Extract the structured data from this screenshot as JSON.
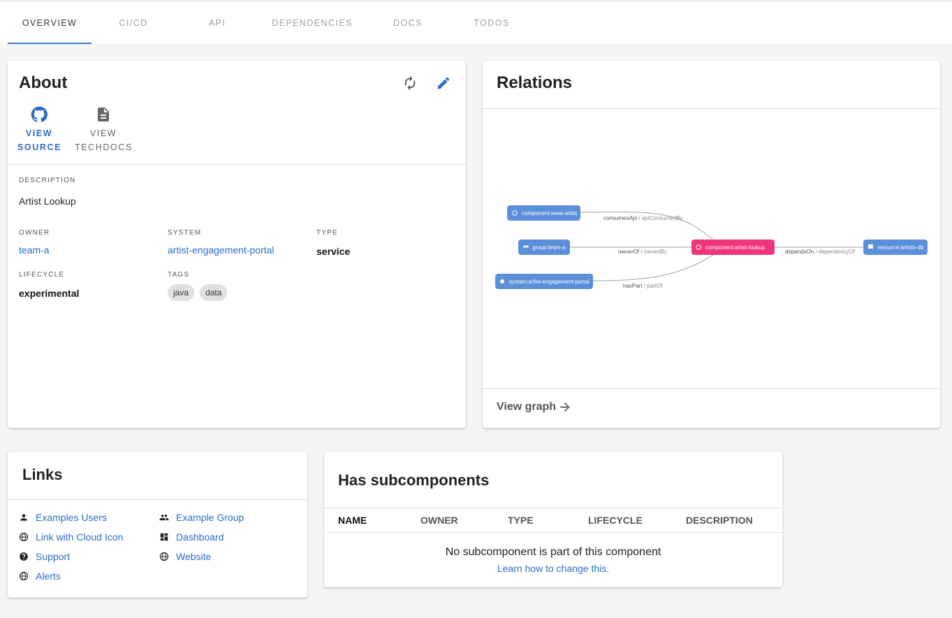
{
  "tabs": [
    "OVERVIEW",
    "CI/CD",
    "API",
    "DEPENDENCIES",
    "DOCS",
    "TODOS"
  ],
  "about": {
    "title": "About",
    "view_source": [
      "VIEW",
      "SOURCE"
    ],
    "view_techdocs": [
      "VIEW",
      "TECHDOCS"
    ],
    "description_label": "DESCRIPTION",
    "description": "Artist Lookup",
    "owner_label": "OWNER",
    "owner": "team-a",
    "system_label": "SYSTEM",
    "system": "artist-engagement-portal",
    "type_label": "TYPE",
    "type": "service",
    "lifecycle_label": "LIFECYCLE",
    "lifecycle": "experimental",
    "tags_label": "TAGS",
    "tags": [
      "java",
      "data"
    ]
  },
  "relations": {
    "title": "Relations",
    "nodes": {
      "www": "component:www-artist",
      "group": "group:team-a",
      "system": "system:artist-engagement-portal",
      "center": "component:artist-lookup",
      "resource": "resource:artists-db"
    },
    "edges": {
      "consumes_a": "consumesApi",
      "consumes_b": " / apiConsumedBy",
      "owner_a": "ownerOf",
      "owner_b": " / ownedBy",
      "haspart_a": "hasPart",
      "haspart_b": " / partOf",
      "depends_a": "dependsOn",
      "depends_b": " / dependencyOf"
    },
    "view_graph": "View graph"
  },
  "links": {
    "title": "Links",
    "items": [
      {
        "label": "Examples Users",
        "icon": "person-icon"
      },
      {
        "label": "Example Group",
        "icon": "group-icon"
      },
      {
        "label": "Link with Cloud Icon",
        "icon": "globe-icon"
      },
      {
        "label": "Dashboard",
        "icon": "dashboard-icon"
      },
      {
        "label": "Support",
        "icon": "help-icon"
      },
      {
        "label": "Website",
        "icon": "globe-icon"
      },
      {
        "label": "Alerts",
        "icon": "globe-icon"
      }
    ]
  },
  "subcomponents": {
    "title": "Has subcomponents",
    "columns": [
      "NAME",
      "OWNER",
      "TYPE",
      "LIFECYCLE",
      "DESCRIPTION"
    ],
    "empty_text": "No subcomponent is part of this component",
    "learn_link": "Learn how to change this."
  },
  "colors": {
    "accent": "#3a79c8",
    "node_blue": "#5b8fd9",
    "node_pink": "#f0357d"
  }
}
